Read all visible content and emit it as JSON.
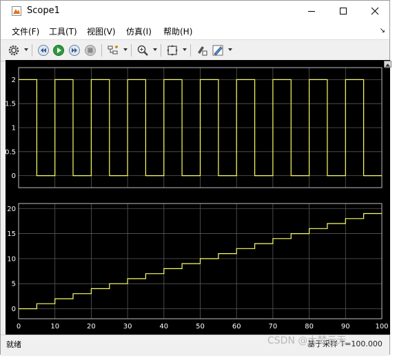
{
  "window": {
    "title": "Scope1"
  },
  "menu": [
    "文件(F)",
    "工具(T)",
    "视图(V)",
    "仿真(I)",
    "帮助(H)"
  ],
  "toolbar": [
    "settings-icon",
    "step-back-icon",
    "run-icon",
    "step-forward-icon",
    "stop-icon",
    "signal-select-icon",
    "zoom-icon",
    "autoscale-icon",
    "highlight-block-icon",
    "style-icon"
  ],
  "status": {
    "left": "就绪",
    "right": "基于采样   T=100.000"
  },
  "watermark": "CSDN @大梦云无",
  "background_fragment": "u",
  "colors": {
    "plot_bg": "#000000",
    "trace": "#ffff66",
    "grid": "#5a5a5a",
    "axes": "#c0c0c0"
  },
  "chart_data": [
    {
      "type": "line",
      "x": [
        0,
        5,
        5,
        10,
        10,
        15,
        15,
        20,
        20,
        25,
        25,
        30,
        30,
        35,
        35,
        40,
        40,
        45,
        45,
        50,
        50,
        55,
        55,
        60,
        60,
        65,
        65,
        70,
        70,
        75,
        75,
        80,
        80,
        85,
        85,
        90,
        90,
        95,
        95,
        100
      ],
      "y": [
        2,
        2,
        0,
        0,
        2,
        2,
        0,
        0,
        2,
        2,
        0,
        0,
        2,
        2,
        0,
        0,
        2,
        2,
        0,
        0,
        2,
        2,
        0,
        0,
        2,
        2,
        0,
        0,
        2,
        2,
        0,
        0,
        2,
        2,
        0,
        0,
        2,
        2,
        0,
        0
      ],
      "xlim": [
        0,
        100
      ],
      "ylim": [
        -0.25,
        2.25
      ],
      "yticks": [
        0,
        0.5,
        1,
        1.5,
        2
      ],
      "ytick_labels": [
        "0",
        "0.5",
        "1",
        "1.5",
        "2"
      ],
      "grid": true
    },
    {
      "type": "line",
      "x": [
        0,
        5,
        5,
        10,
        10,
        15,
        15,
        20,
        20,
        25,
        25,
        30,
        30,
        35,
        35,
        40,
        40,
        45,
        45,
        50,
        50,
        55,
        55,
        60,
        60,
        65,
        65,
        70,
        70,
        75,
        75,
        80,
        80,
        85,
        85,
        90,
        90,
        95,
        95,
        100
      ],
      "y": [
        0,
        0,
        1,
        1,
        2,
        2,
        3,
        3,
        4,
        4,
        5,
        5,
        6,
        6,
        7,
        7,
        8,
        8,
        9,
        9,
        10,
        10,
        11,
        11,
        12,
        12,
        13,
        13,
        14,
        14,
        15,
        15,
        16,
        16,
        17,
        17,
        18,
        18,
        19,
        19
      ],
      "xlim": [
        0,
        100
      ],
      "ylim": [
        -2,
        21
      ],
      "yticks": [
        0,
        5,
        10,
        15,
        20
      ],
      "ytick_labels": [
        "0",
        "5",
        "10",
        "15",
        "20"
      ],
      "xticks": [
        0,
        10,
        20,
        30,
        40,
        50,
        60,
        70,
        80,
        90,
        100
      ],
      "xtick_labels": [
        "0",
        "10",
        "20",
        "30",
        "40",
        "50",
        "60",
        "70",
        "80",
        "90",
        "100"
      ],
      "grid": true
    }
  ]
}
